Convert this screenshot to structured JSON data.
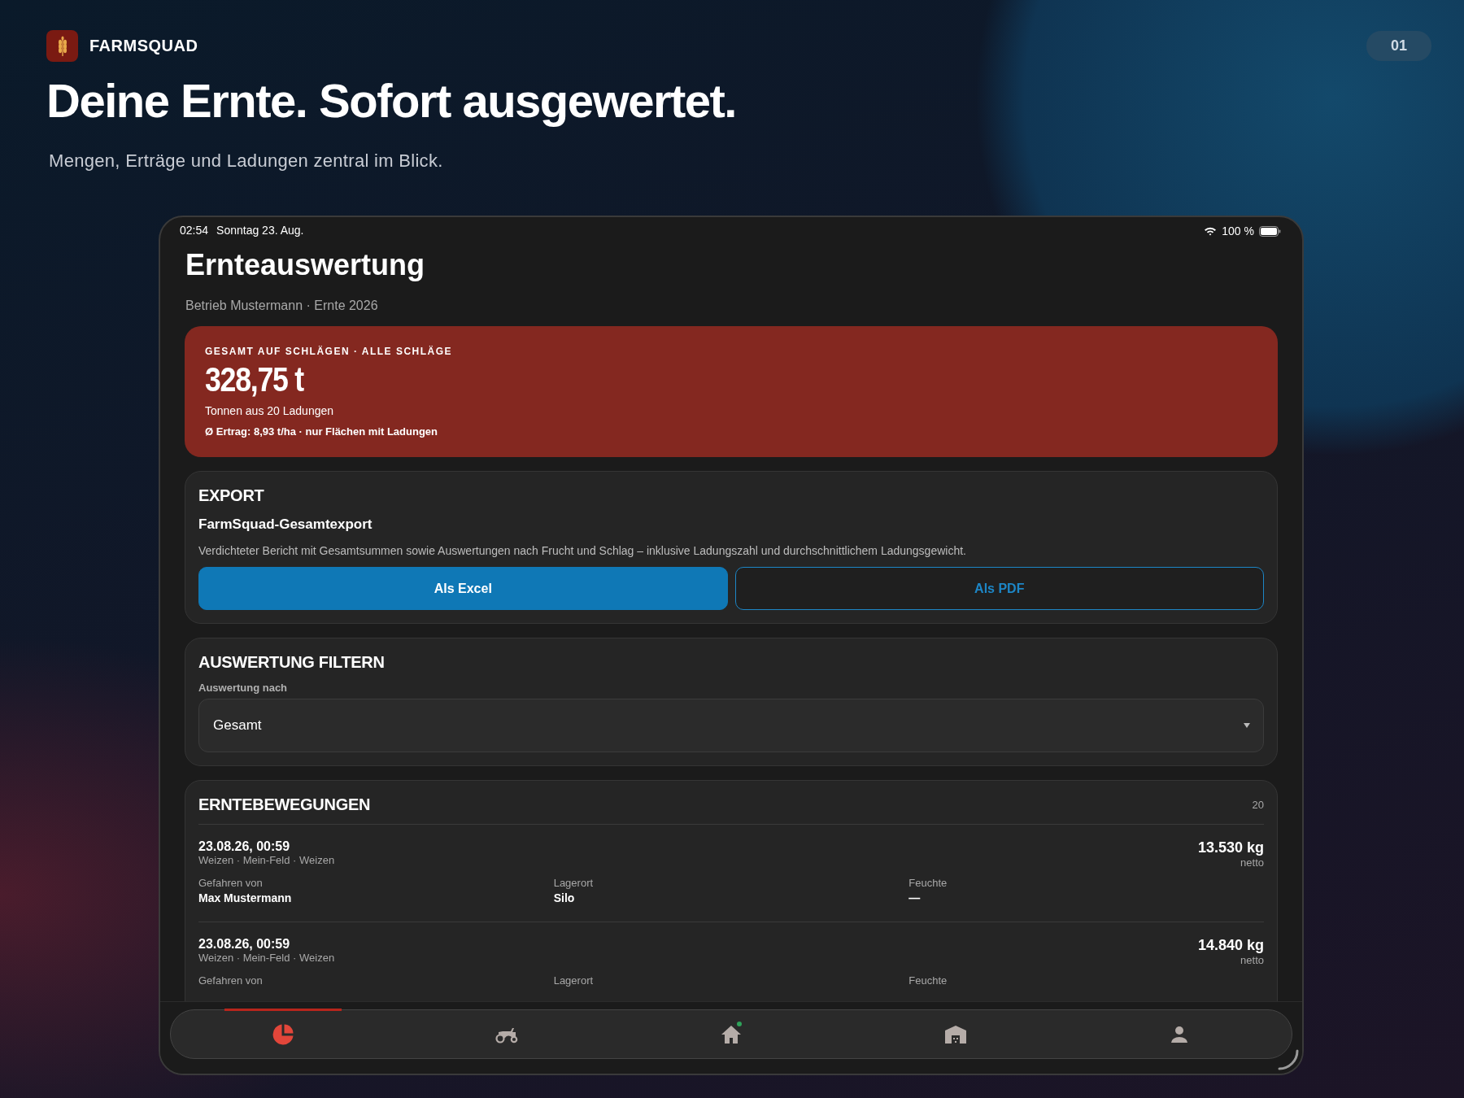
{
  "brand": {
    "name": "FARMSQUAD"
  },
  "page_number": "01",
  "headline": "Deine Ernte. Sofort ausgewertet.",
  "subheadline": "Mengen, Erträge und Ladungen zentral im Blick.",
  "status_bar": {
    "time": "02:54",
    "date": "Sonntag 23. Aug.",
    "battery": "100 %"
  },
  "screen": {
    "title": "Ernteauswertung",
    "subtitle": "Betrieb Mustermann · Ernte 2026",
    "summary": {
      "label": "GESAMT AUF SCHLÄGEN · ALLE SCHLÄGE",
      "value": "328,75 t",
      "detail": "Tonnen aus 20 Ladungen",
      "yield": "Ø Ertrag: 8,93 t/ha · nur Flächen mit Ladungen"
    },
    "export": {
      "heading": "EXPORT",
      "title": "FarmSquad-Gesamtexport",
      "description": "Verdichteter Bericht mit Gesamtsummen sowie Auswertungen nach Frucht und Schlag – inklusive Ladungszahl und durchschnittlichem Ladungsgewicht.",
      "buttons": [
        {
          "label": "Als Excel",
          "kind": "primary"
        },
        {
          "label": "Als PDF",
          "kind": "outline"
        }
      ]
    },
    "filter": {
      "heading": "AUSWERTUNG FILTERN",
      "label": "Auswertung nach",
      "value": "Gesamt"
    },
    "movements": {
      "heading": "ERNTEBEWEGUNGEN",
      "count": "20",
      "rows": [
        {
          "datetime": "23.08.26, 00:59",
          "details": "Weizen · Mein-Feld · Weizen",
          "weight": "13.530 kg",
          "weight_label": "netto",
          "fields": [
            {
              "label": "Gefahren von",
              "value": "Max Mustermann"
            },
            {
              "label": "Lagerort",
              "value": "Silo"
            },
            {
              "label": "Feuchte",
              "value": "—"
            }
          ]
        },
        {
          "datetime": "23.08.26, 00:59",
          "details": "Weizen · Mein-Feld · Weizen",
          "weight": "14.840 kg",
          "weight_label": "netto",
          "fields": [
            {
              "label": "Gefahren von"
            },
            {
              "label": "Lagerort"
            },
            {
              "label": "Feuchte"
            }
          ]
        }
      ]
    }
  },
  "tab_bar": [
    {
      "kind": "chart",
      "selected": true,
      "dot": false
    },
    {
      "kind": "tractor",
      "selected": false,
      "dot": false
    },
    {
      "kind": "home",
      "selected": false,
      "dot": true
    },
    {
      "kind": "barn",
      "selected": false,
      "dot": false
    },
    {
      "kind": "person",
      "selected": false,
      "dot": false
    }
  ]
}
